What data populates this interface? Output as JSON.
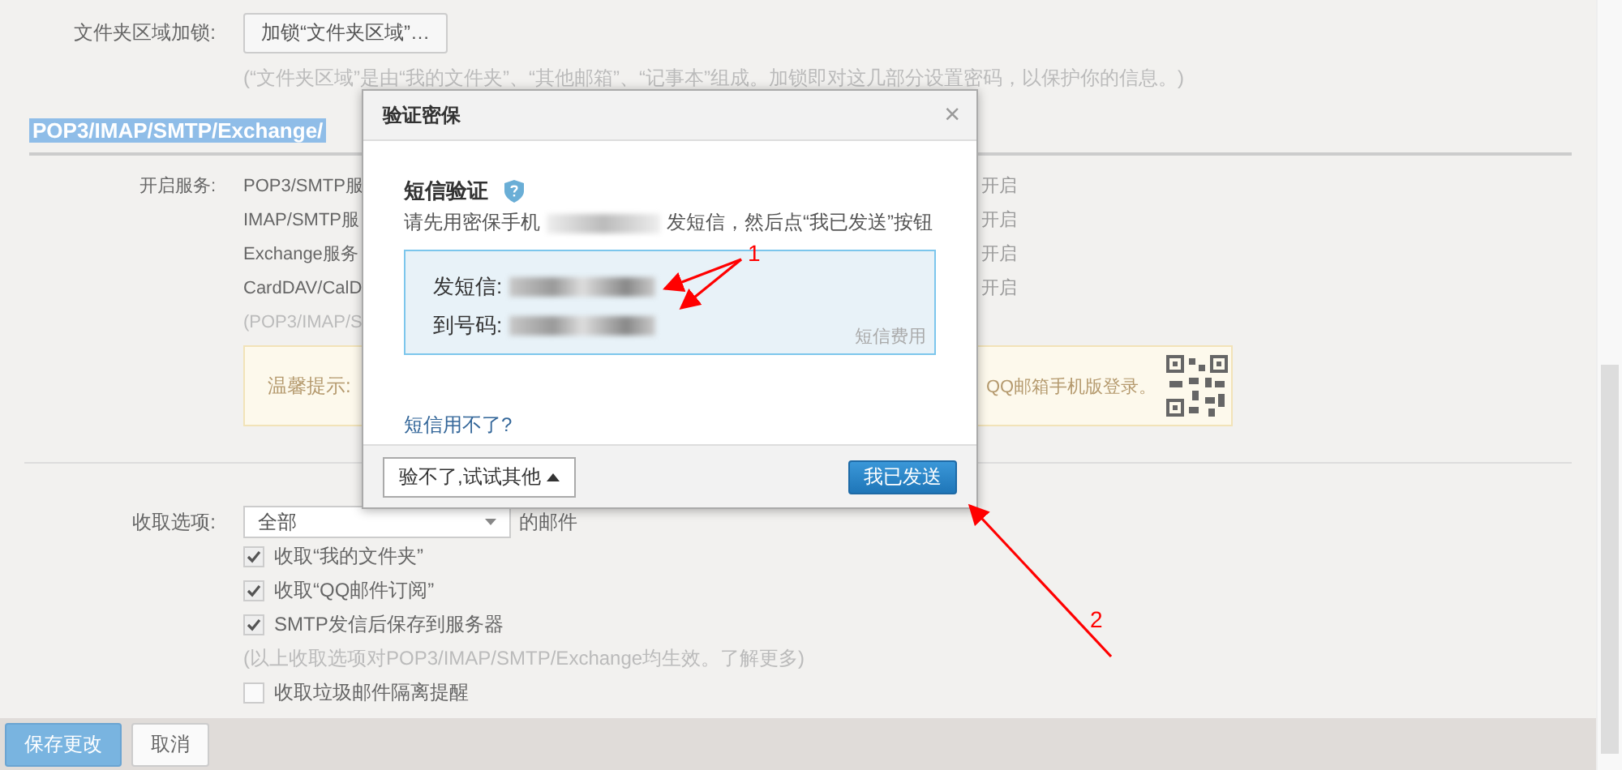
{
  "lock": {
    "label": "文件夹区域加锁:",
    "button": "加锁“文件夹区域”…",
    "hint": "(“文件夹区域”是由“我的文件夹”、“其他邮箱”、“记事本”组成。加锁即对这几部分设置密码，以保护你的信息。)"
  },
  "section_heading": "POP3/IMAP/SMTP/Exchange/",
  "services": {
    "label": "开启服务:",
    "rows": [
      {
        "name": "POP3/SMTP服",
        "action": "开启"
      },
      {
        "name": "IMAP/SMTP服",
        "action": "开启"
      },
      {
        "name": "Exchange服务",
        "action": "开启"
      },
      {
        "name": "CardDAV/CalD",
        "action": "开启"
      }
    ],
    "note": "(POP3/IMAP/S"
  },
  "tip": {
    "title": "温馨提示:",
    "text": "QQ邮箱手机版登录。"
  },
  "receive": {
    "label": "收取选项:",
    "select": "全部",
    "suffix": "的邮件",
    "options": [
      {
        "label": "收取“我的文件夹”",
        "checked": true
      },
      {
        "label": "收取“QQ邮件订阅”",
        "checked": true
      },
      {
        "label": "SMTP发信后保存到服务器",
        "checked": true
      }
    ],
    "hint": "(以上收取选项对POP3/IMAP/SMTP/Exchange均生效。了解更多)",
    "extra_option": {
      "label": "收取垃圾邮件隔离提醒",
      "checked": false
    }
  },
  "footer": {
    "save": "保存更改",
    "cancel": "取消"
  },
  "dialog": {
    "title": "验证密保",
    "close": "×",
    "heading": "短信验证",
    "instruction_prefix": "请先用密保手机",
    "instruction_suffix": "发短信，然后点“我已发送”按钮",
    "send_label": "发短信:",
    "to_label": "到号码:",
    "fee": "短信费用",
    "help_link": "短信用不了?",
    "other_button": "验不了,试试其他",
    "confirm_button": "我已发送"
  },
  "annotations": [
    {
      "label": "1"
    },
    {
      "label": "2"
    }
  ]
}
